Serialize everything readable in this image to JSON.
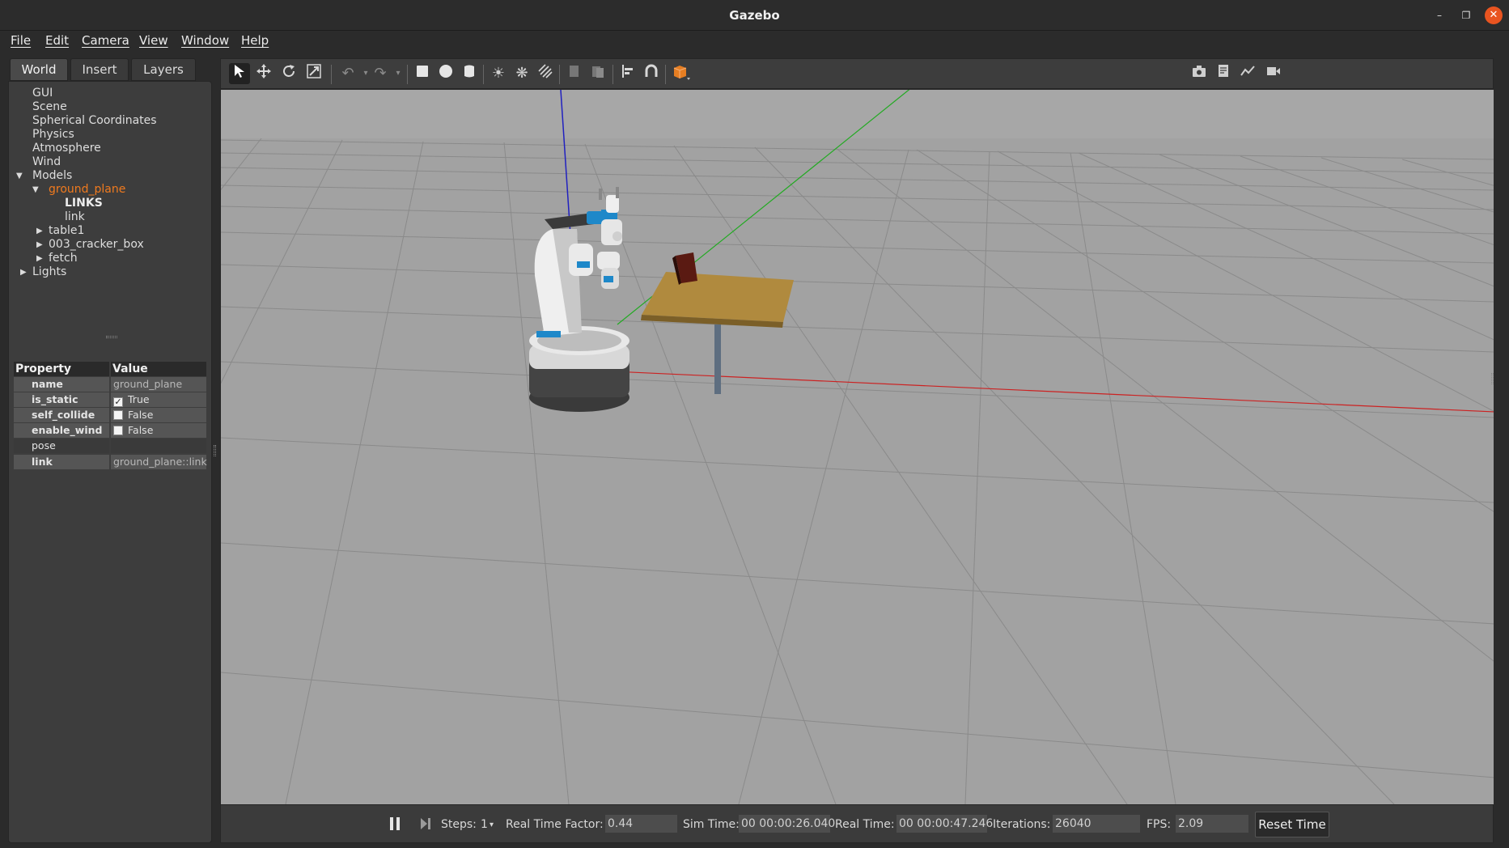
{
  "window": {
    "title": "Gazebo"
  },
  "menu": [
    "File",
    "Edit",
    "Camera",
    "View",
    "Window",
    "Help"
  ],
  "left_tabs": [
    "World",
    "Insert",
    "Layers"
  ],
  "tree": {
    "gui": "GUI",
    "scene": "Scene",
    "spherical": "Spherical Coordinates",
    "physics": "Physics",
    "atmosphere": "Atmosphere",
    "wind": "Wind",
    "models": "Models",
    "ground_plane": "ground_plane",
    "links_header": "LINKS",
    "link": "link",
    "table1": "table1",
    "cracker": "003_cracker_box",
    "fetch": "fetch",
    "lights": "Lights"
  },
  "properties": {
    "header_property": "Property",
    "header_value": "Value",
    "rows": [
      {
        "name": "name",
        "value": "ground_plane"
      },
      {
        "name": "is_static",
        "value": "True",
        "checked": true
      },
      {
        "name": "self_collide",
        "value": "False",
        "checked": false
      },
      {
        "name": "enable_wind",
        "value": "False",
        "checked": false
      },
      {
        "name": "pose",
        "value": ""
      },
      {
        "name": "link",
        "value": "ground_plane::link"
      }
    ]
  },
  "toolbar": {
    "icons": [
      "select-icon",
      "translate-icon",
      "rotate-icon",
      "scale-icon",
      "undo-icon",
      "redo-icon",
      "box-icon",
      "sphere-icon",
      "cylinder-icon",
      "point-light-icon",
      "spot-light-icon",
      "directional-light-icon",
      "copy-icon",
      "paste-icon",
      "align-icon",
      "snap-icon",
      "view-angle-icon",
      "screenshot-icon",
      "log-icon",
      "plot-icon",
      "record-icon"
    ]
  },
  "bottom": {
    "steps_label": "Steps:",
    "steps_value": "1",
    "rtf_label": "Real Time Factor:",
    "rtf_value": "0.44",
    "sim_time_label": "Sim Time:",
    "sim_time_value": "00 00:00:26.040",
    "real_time_label": "Real Time:",
    "real_time_value": "00 00:00:47.246",
    "iterations_label": "Iterations:",
    "iterations_value": "26040",
    "fps_label": "FPS:",
    "fps_value": "2.09",
    "reset_label": "Reset Time"
  },
  "colors": {
    "accent": "#f07a1e",
    "close_button": "#e95420",
    "viewport_bg": "#a0a0a0"
  }
}
